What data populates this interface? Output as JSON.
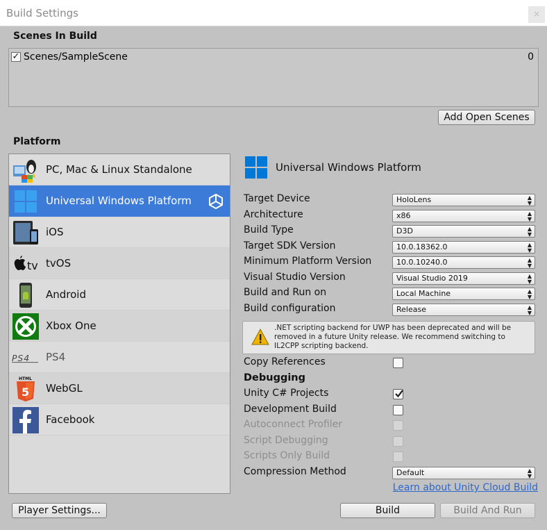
{
  "window": {
    "title": "Build Settings",
    "close_glyph": "×"
  },
  "scenes": {
    "heading": "Scenes In Build",
    "items": [
      {
        "checked": true,
        "name": "Scenes/SampleScene",
        "index": "0"
      }
    ],
    "add_open_scenes_label": "Add Open Scenes"
  },
  "platform": {
    "heading": "Platform",
    "items": [
      {
        "label": "PC, Mac & Linux Standalone",
        "icon": "pc-mac-linux-icon",
        "selected": false
      },
      {
        "label": "Universal Windows Platform",
        "icon": "windows-logo-icon",
        "selected": true
      },
      {
        "label": "iOS",
        "icon": "ios-device-icon",
        "selected": false
      },
      {
        "label": "tvOS",
        "icon": "apple-tv-icon",
        "selected": false
      },
      {
        "label": "Android",
        "icon": "android-phone-icon",
        "selected": false
      },
      {
        "label": "Xbox One",
        "icon": "xbox-logo-icon",
        "selected": false
      },
      {
        "label": "PS4",
        "icon": "ps4-logo-icon",
        "selected": false
      },
      {
        "label": "WebGL",
        "icon": "html5-logo-icon",
        "selected": false
      },
      {
        "label": "Facebook",
        "icon": "facebook-logo-icon",
        "selected": false
      }
    ]
  },
  "settings": {
    "platform_title": "Universal Windows Platform",
    "rows": [
      {
        "label": "Target Device",
        "value": "HoloLens"
      },
      {
        "label": "Architecture",
        "value": "x86"
      },
      {
        "label": "Build Type",
        "value": "D3D"
      },
      {
        "label": "Target SDK Version",
        "value": "10.0.18362.0"
      },
      {
        "label": "Minimum Platform Version",
        "value": "10.0.10240.0"
      },
      {
        "label": "Visual Studio Version",
        "value": "Visual Studio 2019"
      },
      {
        "label": "Build and Run on",
        "value": "Local Machine"
      },
      {
        "label": "Build configuration",
        "value": "Release"
      }
    ],
    "warning": ".NET scripting backend for UWP has been deprecated and will be removed in a future Unity release. We recommend switching to IL2CPP scripting backend.",
    "copy_references": {
      "label": "Copy References",
      "checked": false
    },
    "debugging_heading": "Debugging",
    "debug_options": [
      {
        "label": "Unity C# Projects",
        "checked": true,
        "enabled": true
      },
      {
        "label": "Development Build",
        "checked": false,
        "enabled": true
      },
      {
        "label": "Autoconnect Profiler",
        "checked": false,
        "enabled": false
      },
      {
        "label": "Script Debugging",
        "checked": false,
        "enabled": false
      },
      {
        "label": "Scripts Only Build",
        "checked": false,
        "enabled": false
      }
    ],
    "compression": {
      "label": "Compression Method",
      "value": "Default"
    },
    "cloud_link": "Learn about Unity Cloud Build"
  },
  "footer": {
    "player_settings_label": "Player Settings...",
    "build_label": "Build",
    "build_and_run_label": "Build And Run"
  },
  "colors": {
    "selection": "#3d7bd9",
    "link": "#2f67c9",
    "windows_blue": "#0078d7",
    "xbox_green": "#107c10",
    "html5_orange": "#e34f26",
    "facebook_blue": "#3b5998"
  }
}
